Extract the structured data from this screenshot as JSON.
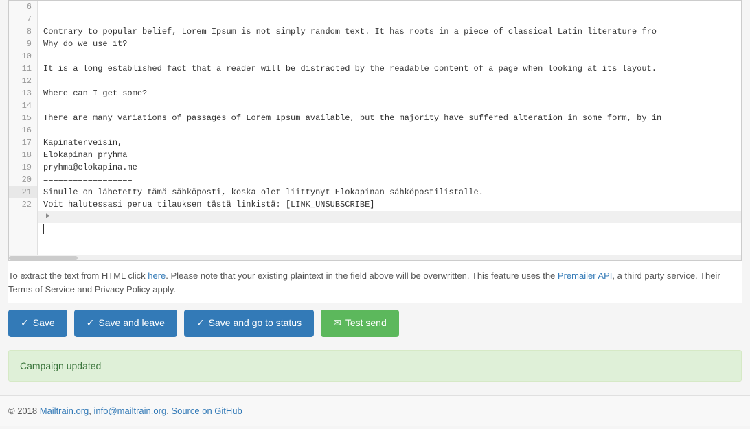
{
  "editor": {
    "lines": [
      {
        "num": 6,
        "content": "Contrary to popular belief, Lorem Ipsum is not simply random text. It has roots in a piece of classical Latin literature fro",
        "active": false
      },
      {
        "num": 7,
        "content": "Why do we use it?",
        "active": false
      },
      {
        "num": 8,
        "content": "",
        "active": false
      },
      {
        "num": 9,
        "content": "It is a long established fact that a reader will be distracted by the readable content of a page when looking at its layout.",
        "active": false
      },
      {
        "num": 10,
        "content": "",
        "active": false
      },
      {
        "num": 11,
        "content": "Where can I get some?",
        "active": false
      },
      {
        "num": 12,
        "content": "",
        "active": false
      },
      {
        "num": 13,
        "content": "There are many variations of passages of Lorem Ipsum available, but the majority have suffered alteration in some form, by in",
        "active": false
      },
      {
        "num": 14,
        "content": "",
        "active": false
      },
      {
        "num": 15,
        "content": "Kapinaterveisin,",
        "active": false
      },
      {
        "num": 16,
        "content": "Elokapinan pryhma",
        "active": false
      },
      {
        "num": 17,
        "content": "pryhma@elokapina.me",
        "active": false
      },
      {
        "num": 18,
        "content": "==================",
        "active": false
      },
      {
        "num": 19,
        "content": "Sinulle on lähetetty tämä sähköposti, koska olet liittynyt Elokapinan sähköpostilistalle.",
        "active": false
      },
      {
        "num": 20,
        "content": "Voit halutessasi perua tilauksen tästä linkistä: [LINK_UNSUBSCRIBE]",
        "active": false
      },
      {
        "num": 21,
        "content": "",
        "active": true,
        "arrow": true
      },
      {
        "num": 22,
        "content": "",
        "active": false,
        "cursor": true
      }
    ]
  },
  "info": {
    "text": "To extract the text from HTML click ",
    "link_here": "here",
    "text2": ". Please note that your existing plaintext in the field above will be overwritten. This feature uses the ",
    "link_premailer": "Premailer API",
    "text3": ", a third party service. Their Terms of Service and Privacy Policy apply."
  },
  "buttons": {
    "save": "Save",
    "save_and_leave": "Save and leave",
    "save_and_go_to_status": "Save and go to status",
    "test_send": "Test send"
  },
  "status": {
    "message": "Campaign updated"
  },
  "footer": {
    "copyright": "© 2018 ",
    "link1_text": "Mailtrain.org",
    "separator1": ", ",
    "link2_text": "info@mailtrain.org",
    "separator2": ". ",
    "link3_text": "Source on GitHub",
    "link1_href": "https://mailtrain.org",
    "link2_href": "mailto:info@mailtrain.org",
    "link3_href": "https://github.com/nicholasess/mailtrain"
  }
}
